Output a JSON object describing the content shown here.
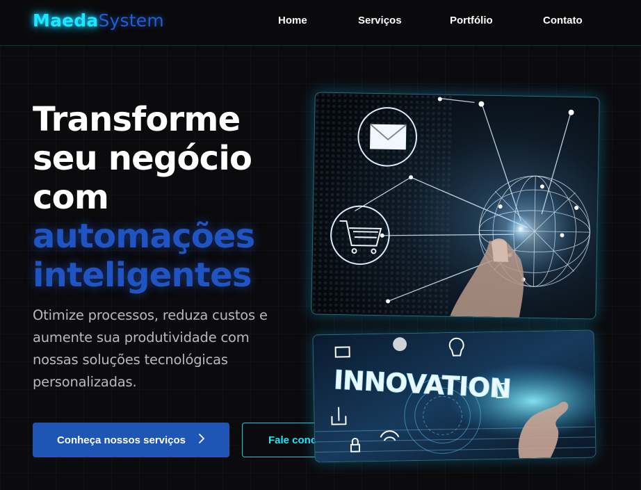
{
  "header": {
    "logo_part1": "Maeda",
    "logo_part2": "System",
    "nav": [
      {
        "label": "Home"
      },
      {
        "label": "Serviços"
      },
      {
        "label": "Portfólio"
      },
      {
        "label": "Contato"
      }
    ]
  },
  "hero": {
    "title_lines": [
      "Transforme",
      "seu negócio",
      "com"
    ],
    "title_accent_lines": [
      "automações",
      "inteligentes"
    ],
    "subtitle": "Otimize processos, reduza custos e aumente sua produtividade com nossas soluções tecnológicas personalizadas.",
    "primary_button": {
      "label": "Conheça nossos serviços",
      "icon": "chevron-right-icon"
    },
    "secondary_button": {
      "label": "Fale conosco"
    }
  },
  "images": {
    "network": {
      "icons": [
        "envelope-icon",
        "shopping-cart-icon"
      ]
    },
    "innovation": {
      "text": "INNOVATION"
    }
  },
  "colors": {
    "background": "#0b0b0e",
    "accent_cyan": "#1ee6ff",
    "accent_blue": "#1f56b5",
    "text_muted": "#b7b9c2"
  }
}
